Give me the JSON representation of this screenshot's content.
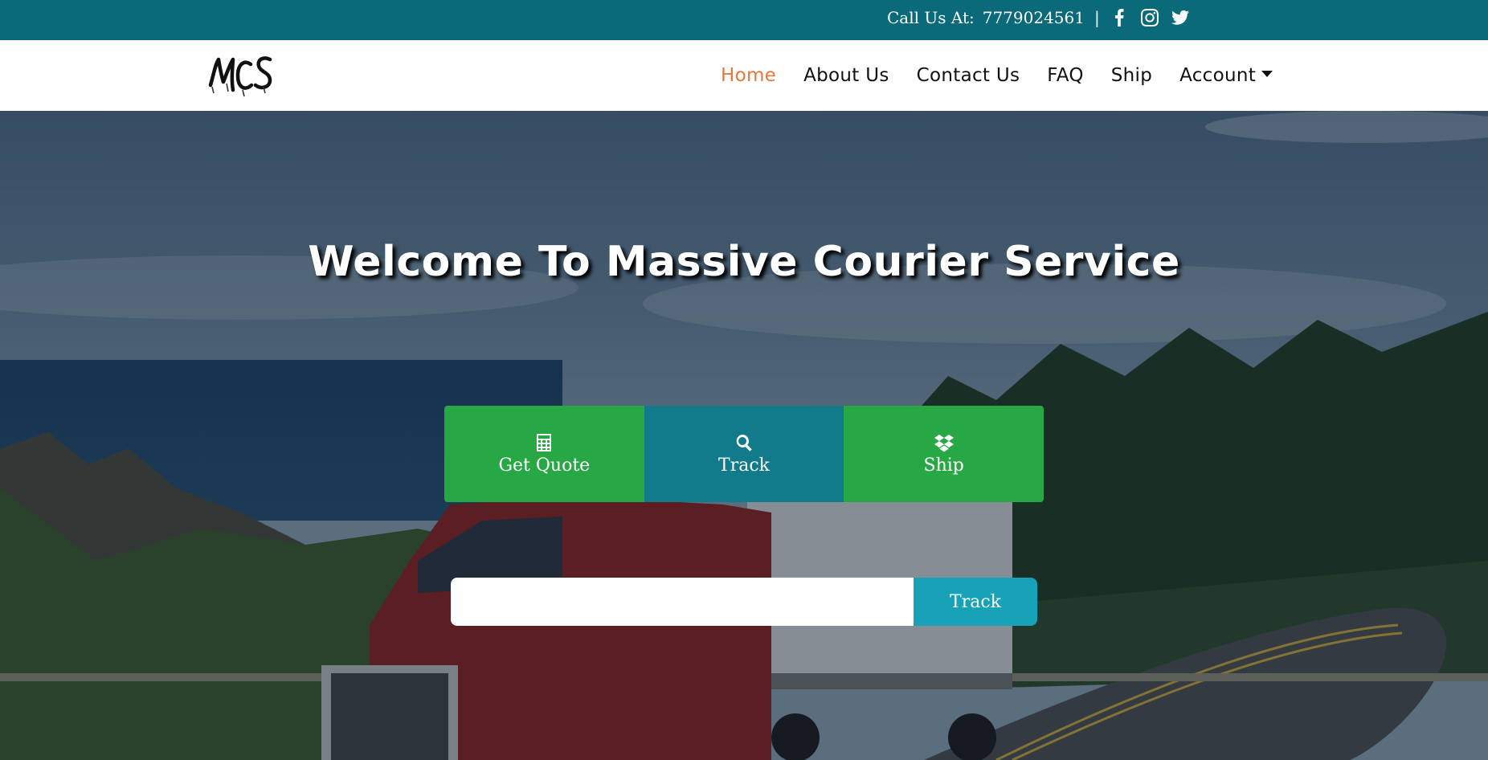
{
  "topbar": {
    "call_label": "Call Us At:",
    "phone": "7779024561",
    "separator": "|",
    "social": [
      "facebook-icon",
      "instagram-icon",
      "twitter-icon"
    ]
  },
  "brand": {
    "logo_text": "MCS"
  },
  "nav": {
    "items": [
      {
        "label": "Home",
        "active": true
      },
      {
        "label": "About Us"
      },
      {
        "label": "Contact Us"
      },
      {
        "label": "FAQ"
      },
      {
        "label": "Ship"
      },
      {
        "label": "Account",
        "has_dropdown": true
      }
    ]
  },
  "hero": {
    "title": "Welcome To Massive Courier Service",
    "tabs": [
      {
        "label": "Get Quote",
        "icon": "calculator-icon"
      },
      {
        "label": "Track",
        "icon": "search-icon"
      },
      {
        "label": "Ship",
        "icon": "dropbox-icon"
      }
    ],
    "track_input": {
      "value": "",
      "placeholder": ""
    },
    "track_button": "Track"
  },
  "colors": {
    "topbar": "#0b6a7a",
    "active_nav": "#e8773a",
    "green": "#28a745",
    "teal_tab": "#117a8b",
    "track_button": "#17a2b8"
  }
}
